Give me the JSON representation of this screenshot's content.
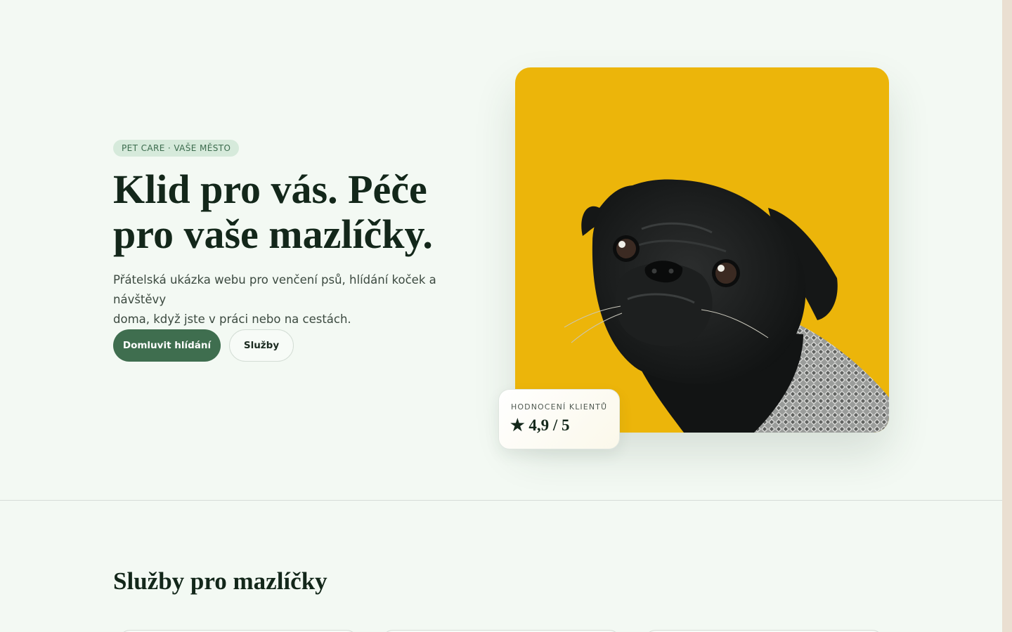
{
  "hero": {
    "badge": "PET CARE · VAŠE MĚSTO",
    "title_line1": "Klid pro vás. Péče",
    "title_line2": "pro vaše mazlíčky.",
    "description_line1": "Přátelská ukázka webu pro venčení psů, hlídání koček a návštěvy",
    "description_line2": "doma, když jste v práci nebo na cestách.",
    "primary_button": "Domluvit hlídání",
    "secondary_button": "Služby"
  },
  "rating": {
    "label": "HODNOCENÍ KLIENTŮ",
    "value": "★ 4,9 / 5"
  },
  "services": {
    "title": "Služby pro mazlíčky"
  },
  "colors": {
    "background": "#f3f9f3",
    "accent_green": "#3f6e4f",
    "photo_background": "#ecb50a",
    "badge_bg": "#d6eadb",
    "text_dark": "#13271a"
  },
  "icons": {
    "rating_star": "star-icon"
  }
}
